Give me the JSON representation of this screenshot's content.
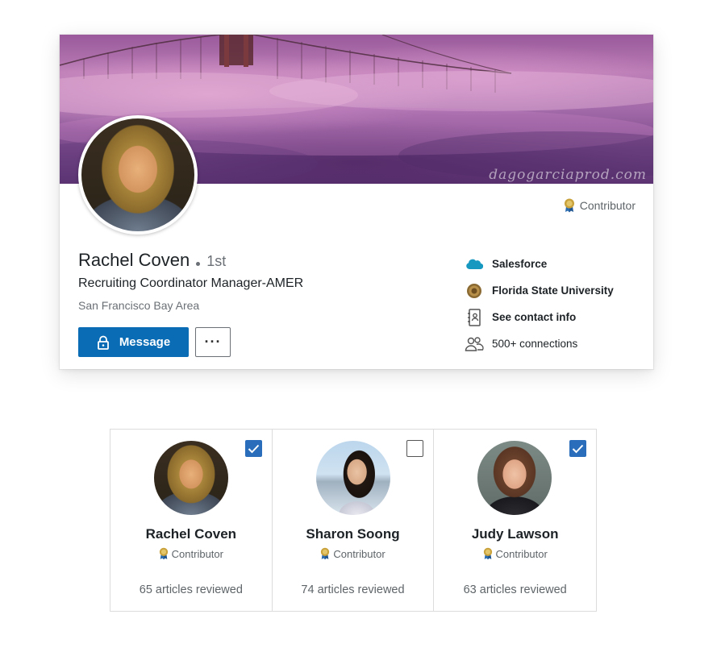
{
  "profile": {
    "name": "Rachel Coven",
    "degree": "1st",
    "headline": "Recruiting Coordinator Manager-AMER",
    "location": "San Francisco Bay Area",
    "badge": "Contributor",
    "banner_watermark": "dagogarciaprod.com",
    "buttons": {
      "message": "Message",
      "more": "···"
    },
    "info": {
      "company": "Salesforce",
      "school": "Florida State University",
      "contact": "See contact info",
      "connections": "500+ connections"
    },
    "icons": {
      "badge": "contributor-medal-icon",
      "company": "salesforce-logo-icon",
      "school": "university-seal-icon",
      "contact": "address-book-icon",
      "connections": "people-icon",
      "message": "lock-icon"
    },
    "colors": {
      "primary": "#0a6cb5",
      "badge_gold": "#c9a23c",
      "badge_ribbon": "#2b6cb0"
    }
  },
  "reviewers": [
    {
      "name": "Rachel Coven",
      "badge": "Contributor",
      "count": "65 articles reviewed",
      "checked": true
    },
    {
      "name": "Sharon Soong",
      "badge": "Contributor",
      "count": "74 articles reviewed",
      "checked": false
    },
    {
      "name": "Judy Lawson",
      "badge": "Contributor",
      "count": "63 articles reviewed",
      "checked": true
    }
  ]
}
